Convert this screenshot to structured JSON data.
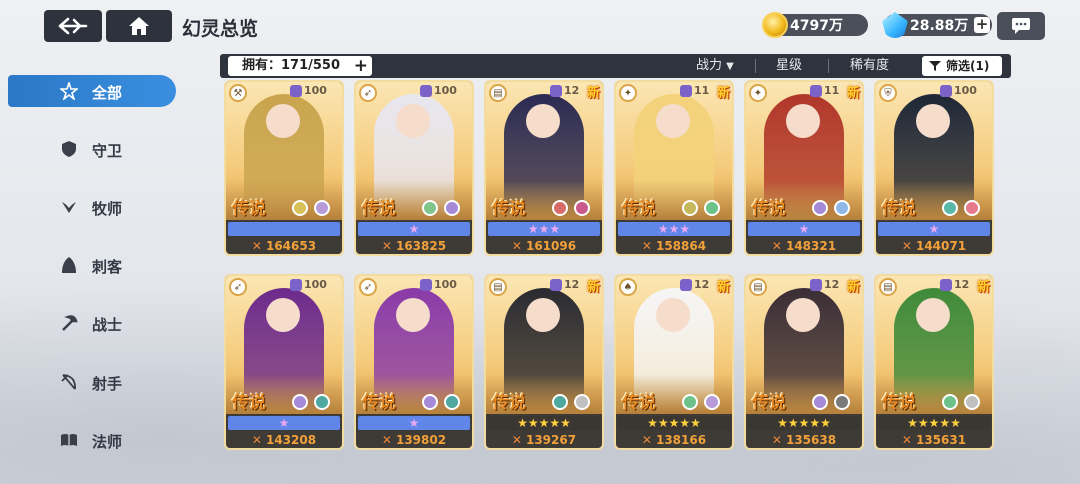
{
  "header": {
    "title": "幻灵总览",
    "gold": "4797万",
    "gems": "28.88万",
    "gem_plus": "+"
  },
  "sidebar": {
    "items": [
      {
        "label": "全部",
        "icon": "all-star-icon",
        "active": true
      },
      {
        "label": "守卫",
        "icon": "guardian-shield-icon",
        "active": false
      },
      {
        "label": "牧师",
        "icon": "priest-wings-icon",
        "active": false
      },
      {
        "label": "刺客",
        "icon": "assassin-hood-icon",
        "active": false
      },
      {
        "label": "战士",
        "icon": "warrior-axe-icon",
        "active": false
      },
      {
        "label": "射手",
        "icon": "archer-bow-icon",
        "active": false
      },
      {
        "label": "法师",
        "icon": "mage-book-icon",
        "active": false
      }
    ]
  },
  "filter_bar": {
    "owned_label": "拥有：171/550",
    "sort_power": "战力",
    "sort_star": "星级",
    "sort_rarity": "稀有度",
    "filter_label": "筛选(1)"
  },
  "cards": [
    {
      "power": "164653",
      "level": "100",
      "rarity": "传说",
      "class": "warrior",
      "new": "",
      "stars": 0,
      "theme": "#c9a44d"
    },
    {
      "power": "163825",
      "level": "100",
      "rarity": "传说",
      "class": "archer",
      "new": "",
      "stars": 1,
      "theme": "#e8e6ef"
    },
    {
      "power": "161096",
      "level": "12",
      "rarity": "传说",
      "class": "mage",
      "new": "新",
      "stars": 3,
      "theme": "#2b2a52"
    },
    {
      "power": "158864",
      "level": "11",
      "rarity": "传说",
      "class": "priest",
      "new": "新",
      "stars": 3,
      "theme": "#f3d27a"
    },
    {
      "power": "148321",
      "level": "11",
      "rarity": "传说",
      "class": "priest",
      "new": "新",
      "stars": 1,
      "theme": "#b0362a"
    },
    {
      "power": "144071",
      "level": "100",
      "rarity": "传说",
      "class": "guardian",
      "new": "",
      "stars": 1,
      "theme": "#1e2636"
    },
    {
      "power": "143208",
      "level": "100",
      "rarity": "传说",
      "class": "archer",
      "new": "",
      "stars": 1,
      "theme": "#6d2a8c"
    },
    {
      "power": "139802",
      "level": "100",
      "rarity": "传说",
      "class": "archer",
      "new": "",
      "stars": 1,
      "theme": "#8a3aa8"
    },
    {
      "power": "139267",
      "level": "12",
      "rarity": "传说",
      "class": "mage",
      "new": "新",
      "stars": 5,
      "theme": "#2a2a30"
    },
    {
      "power": "138166",
      "level": "12",
      "rarity": "传说",
      "class": "assassin",
      "new": "新",
      "stars": 5,
      "theme": "#f5f5f5"
    },
    {
      "power": "135638",
      "level": "12",
      "rarity": "传说",
      "class": "mage",
      "new": "新",
      "stars": 5,
      "theme": "#3a2d35"
    },
    {
      "power": "135631",
      "level": "12",
      "rarity": "传说",
      "class": "mage",
      "new": "新",
      "stars": 5,
      "theme": "#3f8a3a"
    }
  ],
  "colors": {
    "accent": "#3b8fe0",
    "bar_dark": "#2e333e",
    "rarity_orange": "#e68a25",
    "power_orange": "#f2a13a",
    "new_yellow": "#ffcf2e"
  }
}
